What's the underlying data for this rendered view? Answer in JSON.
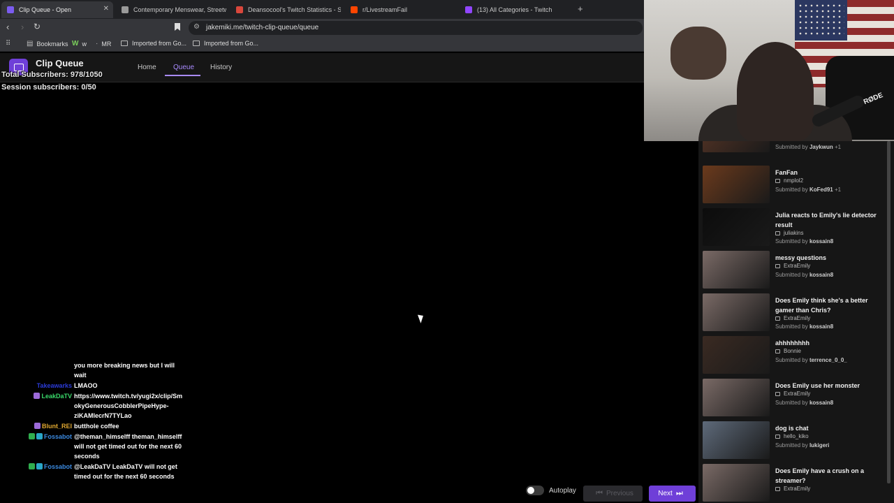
{
  "browser": {
    "tabs": [
      {
        "title": "Clip Queue - Open",
        "fav": "#7b5cf0",
        "active": true
      },
      {
        "title": "Contemporary Menswear, Streetwear",
        "fav": "#9a9a9a",
        "active": false
      },
      {
        "title": "Deansocool's Twitch Statistics - Socia",
        "fav": "#d9473c",
        "active": false
      },
      {
        "title": "r/LivestreamFail",
        "fav": "#ff4500",
        "active": false
      },
      {
        "title": "(13) All Categories - Twitch",
        "fav": "#9146ff",
        "active": false
      }
    ],
    "url": "jakemiki.me/twitch-clip-queue/queue",
    "bookmarks": [
      "Bookmarks",
      "w",
      "MR",
      "Imported from Go...",
      "Imported from Go..."
    ]
  },
  "app": {
    "title": "Clip Queue",
    "nav": [
      "Home",
      "Queue",
      "History"
    ]
  },
  "overlay": {
    "total_subscribers": "Total Subscribers: 978/1050",
    "session_subscribers": "Session subscribers: 0/50"
  },
  "chat": [
    {
      "user": "",
      "color": "#ffffff",
      "badges": [],
      "text": "you more breaking news but I will wait"
    },
    {
      "user": "Takeawarks",
      "color": "#2b3bd8",
      "badges": [],
      "text": "LMAOO"
    },
    {
      "user": "LeakDaTV",
      "color": "#39d96a",
      "badges": [
        "#9c6ad8"
      ],
      "text": "https://www.twitch.tv/yugi2x/clip/SmokyGenerousCobblerPipeHype-ziKAMlecrN7TYLao"
    },
    {
      "user": "Blunt_REI",
      "color": "#e0a830",
      "badges": [
        "#9c6ad8"
      ],
      "text": "butthole coffee"
    },
    {
      "user": "Fossabot",
      "color": "#3b8ae0",
      "badges": [
        "#2fae4e",
        "#2aa7c8"
      ],
      "text": "@theman_himselff theman_himselff will not get timed out for the next 60 seconds"
    },
    {
      "user": "Fossabot",
      "color": "#3b8ae0",
      "badges": [
        "#2fae4e",
        "#2aa7c8"
      ],
      "text": "@LeakDaTV LeakDaTV will not get timed out for the next 60 seconds"
    }
  ],
  "controls": {
    "autoplay": "Autoplay",
    "previous": "Previous",
    "next": "Next"
  },
  "queue": [
    {
      "title": "",
      "channel": "",
      "submitter": "Jaykwun",
      "extra": "+1",
      "thumb": "#5a3626"
    },
    {
      "title": "FanFan",
      "channel": "nmplol2",
      "submitter": "KoFed91",
      "extra": "+1",
      "thumb": "#6b3a1c"
    },
    {
      "title": "Julia reacts to Emily's lie detector result",
      "channel": "juliakins",
      "submitter": "kossain8",
      "extra": "",
      "thumb": "#0c0c0c"
    },
    {
      "title": "messy questions",
      "channel": "ExtraEmily",
      "submitter": "kossain8",
      "extra": "",
      "thumb": "#7a6a66"
    },
    {
      "title": "Does Emily think she's a better gamer than Chris?",
      "channel": "ExtraEmily",
      "submitter": "kossain8",
      "extra": "",
      "thumb": "#7a6a66"
    },
    {
      "title": "ahhhhhhhh",
      "channel": "Bonnie",
      "submitter": "terrence_0_0_",
      "extra": "",
      "thumb": "#3a2a22"
    },
    {
      "title": "Does Emily use her monster",
      "channel": "ExtraEmily",
      "submitter": "kossain8",
      "extra": "",
      "thumb": "#7a6a66"
    },
    {
      "title": "dog is chat",
      "channel": "hello_kiko",
      "submitter": "lukigeri",
      "extra": "",
      "thumb": "#5e6a7a"
    },
    {
      "title": "Does Emily have a crush on a streamer?",
      "channel": "ExtraEmily",
      "submitter": "",
      "extra": "",
      "thumb": "#7a6a66"
    }
  ],
  "queue_submitted_prefix": "Submitted by",
  "webcam": {
    "mic_brand": "RØDE"
  }
}
